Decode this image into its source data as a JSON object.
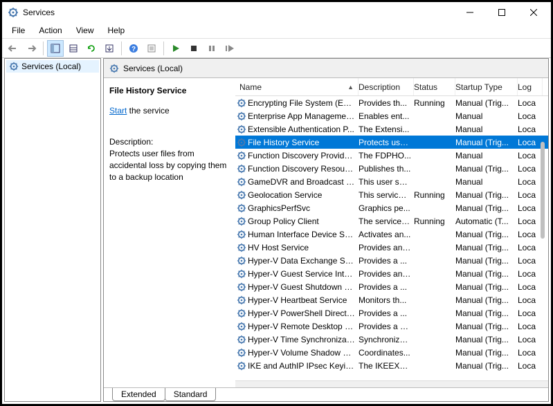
{
  "window": {
    "title": "Services"
  },
  "menu": {
    "file": "File",
    "action": "Action",
    "view": "View",
    "help": "Help"
  },
  "tree": {
    "root": "Services (Local)"
  },
  "header": {
    "title": "Services (Local)"
  },
  "detail": {
    "service_name": "File History Service",
    "start_link": "Start",
    "start_suffix": " the service",
    "description_label": "Description:",
    "description_text": "Protects user files from accidental loss by copying them to a backup location"
  },
  "columns": {
    "name": "Name",
    "description": "Description",
    "status": "Status",
    "startup": "Startup Type",
    "logon": "Log"
  },
  "rows": [
    {
      "name": "Encrypting File System (EFS)",
      "desc": "Provides th...",
      "status": "Running",
      "startup": "Manual (Trig...",
      "log": "Loca",
      "selected": false
    },
    {
      "name": "Enterprise App Managemen...",
      "desc": "Enables ent...",
      "status": "",
      "startup": "Manual",
      "log": "Loca",
      "selected": false
    },
    {
      "name": "Extensible Authentication P...",
      "desc": "The Extensi...",
      "status": "",
      "startup": "Manual",
      "log": "Loca",
      "selected": false
    },
    {
      "name": "File History Service",
      "desc": "Protects use...",
      "status": "",
      "startup": "Manual (Trig...",
      "log": "Loca",
      "selected": true
    },
    {
      "name": "Function Discovery Provide...",
      "desc": "The FDPHO...",
      "status": "",
      "startup": "Manual",
      "log": "Loca",
      "selected": false
    },
    {
      "name": "Function Discovery Resourc...",
      "desc": "Publishes th...",
      "status": "",
      "startup": "Manual (Trig...",
      "log": "Loca",
      "selected": false
    },
    {
      "name": "GameDVR and Broadcast Us...",
      "desc": "This user ser...",
      "status": "",
      "startup": "Manual",
      "log": "Loca",
      "selected": false
    },
    {
      "name": "Geolocation Service",
      "desc": "This service ...",
      "status": "Running",
      "startup": "Manual (Trig...",
      "log": "Loca",
      "selected": false
    },
    {
      "name": "GraphicsPerfSvc",
      "desc": "Graphics pe...",
      "status": "",
      "startup": "Manual (Trig...",
      "log": "Loca",
      "selected": false
    },
    {
      "name": "Group Policy Client",
      "desc": "The service i...",
      "status": "Running",
      "startup": "Automatic (T...",
      "log": "Loca",
      "selected": false
    },
    {
      "name": "Human Interface Device Ser...",
      "desc": "Activates an...",
      "status": "",
      "startup": "Manual (Trig...",
      "log": "Loca",
      "selected": false
    },
    {
      "name": "HV Host Service",
      "desc": "Provides an ...",
      "status": "",
      "startup": "Manual (Trig...",
      "log": "Loca",
      "selected": false
    },
    {
      "name": "Hyper-V Data Exchange Ser...",
      "desc": "Provides a ...",
      "status": "",
      "startup": "Manual (Trig...",
      "log": "Loca",
      "selected": false
    },
    {
      "name": "Hyper-V Guest Service Inter...",
      "desc": "Provides an ...",
      "status": "",
      "startup": "Manual (Trig...",
      "log": "Loca",
      "selected": false
    },
    {
      "name": "Hyper-V Guest Shutdown S...",
      "desc": "Provides a ...",
      "status": "",
      "startup": "Manual (Trig...",
      "log": "Loca",
      "selected": false
    },
    {
      "name": "Hyper-V Heartbeat Service",
      "desc": "Monitors th...",
      "status": "",
      "startup": "Manual (Trig...",
      "log": "Loca",
      "selected": false
    },
    {
      "name": "Hyper-V PowerShell Direct ...",
      "desc": "Provides a ...",
      "status": "",
      "startup": "Manual (Trig...",
      "log": "Loca",
      "selected": false
    },
    {
      "name": "Hyper-V Remote Desktop Vi...",
      "desc": "Provides a p...",
      "status": "",
      "startup": "Manual (Trig...",
      "log": "Loca",
      "selected": false
    },
    {
      "name": "Hyper-V Time Synchronizati...",
      "desc": "Synchronize...",
      "status": "",
      "startup": "Manual (Trig...",
      "log": "Loca",
      "selected": false
    },
    {
      "name": "Hyper-V Volume Shadow C...",
      "desc": "Coordinates...",
      "status": "",
      "startup": "Manual (Trig...",
      "log": "Loca",
      "selected": false
    },
    {
      "name": "IKE and AuthIP IPsec Keying...",
      "desc": "The IKEEXT ...",
      "status": "",
      "startup": "Manual (Trig...",
      "log": "Loca",
      "selected": false
    }
  ],
  "tabs": {
    "extended": "Extended",
    "standard": "Standard"
  }
}
